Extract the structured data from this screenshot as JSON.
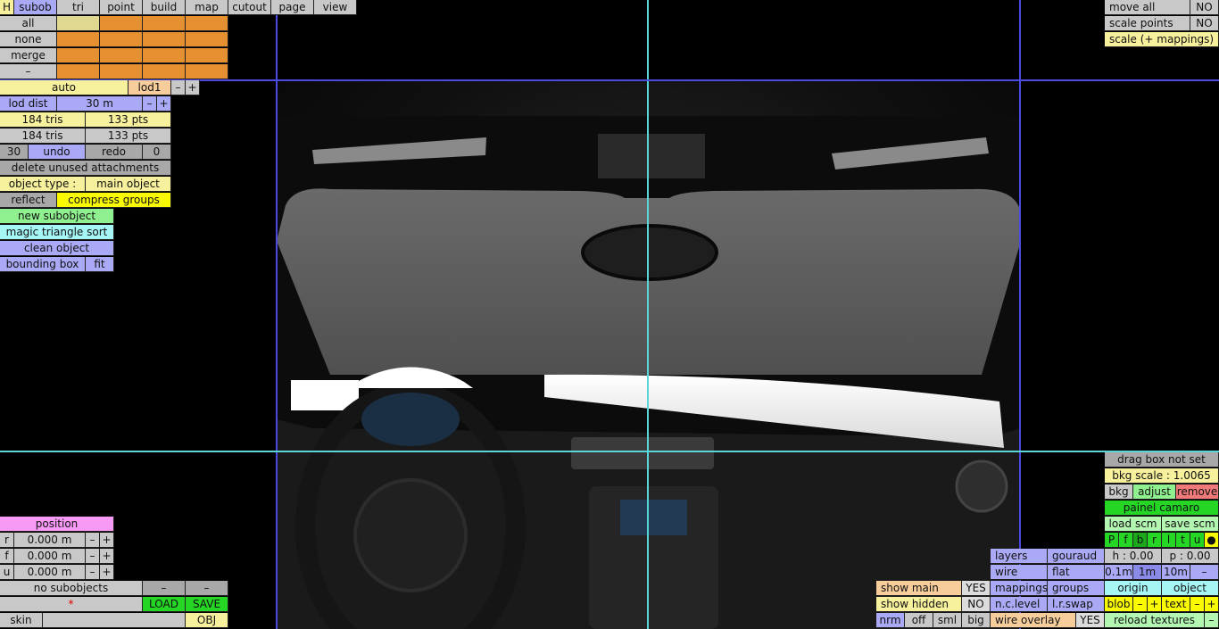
{
  "menu": {
    "h": "H",
    "subob": "subob",
    "tri": "tri",
    "point": "point",
    "build": "build",
    "map": "map",
    "cutout": "cutout",
    "page": "page",
    "view": "view"
  },
  "sel": {
    "all": "all",
    "none": "none",
    "merge": "merge",
    "minus": "–"
  },
  "lod": {
    "auto": "auto",
    "lod1": "lod1",
    "minus": "–",
    "plus": "+",
    "dist_label": "lod dist",
    "dist_value": "30 m",
    "dminus": "–",
    "dplus": "+"
  },
  "stats": {
    "tris1": "184 tris",
    "pts1": "133 pts",
    "tris2": "184 tris",
    "pts2": "133 pts"
  },
  "undo": {
    "count": "30",
    "undo": "undo",
    "redo": "redo",
    "redo_count": "0"
  },
  "actions": {
    "delete_unused": "delete unused attachments",
    "object_type_label": "object type :",
    "object_type_value": "main object",
    "reflect": "reflect",
    "compress": "compress groups",
    "new_subobject": "new subobject",
    "magic": "magic triangle sort",
    "clean": "clean object",
    "bounding": "bounding box",
    "fit": "fit"
  },
  "position": {
    "title": "position",
    "rows": [
      {
        "axis": "r",
        "value": "0.000 m",
        "minus": "–",
        "plus": "+"
      },
      {
        "axis": "f",
        "value": "0.000 m",
        "minus": "–",
        "plus": "+"
      },
      {
        "axis": "u",
        "value": "0.000 m",
        "minus": "–",
        "plus": "+"
      }
    ]
  },
  "subobjects": {
    "status": "no subobjects",
    "m1": "–",
    "m2": "–",
    "star": "*",
    "load": "LOAD",
    "save": "SAVE",
    "skin": "skin",
    "obj": "OBJ"
  },
  "topright": {
    "move_all": "move all",
    "move_all_v": "NO",
    "scale_points": "scale points",
    "scale_points_v": "NO",
    "scale_map": "scale (+ mappings)"
  },
  "bkg": {
    "drag": "drag box not set",
    "scale": "bkg scale : 1.0065",
    "bkg": "bkg",
    "adjust": "adjust",
    "remove": "remove",
    "name": "painel camaro",
    "load_scm": "load scm",
    "save_scm": "save scm",
    "letters": [
      "P",
      "f",
      "b",
      "r",
      "l",
      "t",
      "u",
      "●"
    ],
    "h": "h : 0.00",
    "p": "p : 0.00",
    "steps": [
      "0.1m",
      "1m",
      "10m",
      "–"
    ],
    "origin": "origin",
    "object": "object",
    "blob": "blob",
    "bminus": "–",
    "bplus": "+",
    "text": "text",
    "tminus": "–",
    "tplus": "+",
    "reload": "reload textures",
    "rminus": "–"
  },
  "view": {
    "layers": "layers",
    "gouraud": "gouraud",
    "wire": "wire",
    "flat": "flat",
    "mappings": "mappings",
    "groups": "groups",
    "nclevel": "n.c.level",
    "lrswap": "l.r.swap",
    "show_main": "show main",
    "show_main_v": "YES",
    "show_hidden": "show hidden",
    "show_hidden_v": "NO",
    "nrm": "nrm",
    "off": "off",
    "sml": "sml",
    "big": "big",
    "wire_overlay": "wire overlay",
    "wire_overlay_v": "YES"
  },
  "colors": {
    "guide_blue": "#4a4ae0",
    "guide_cyan": "#5ad6d6"
  }
}
